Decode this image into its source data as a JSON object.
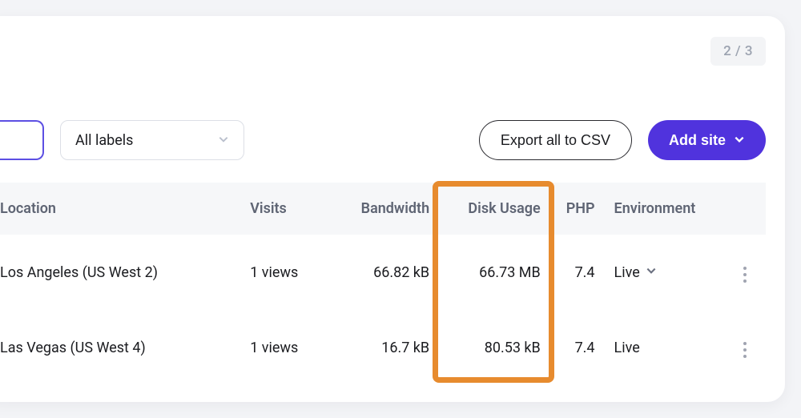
{
  "pagination": {
    "label": "2 / 3"
  },
  "toolbar": {
    "labels_filter": {
      "text": "All labels"
    },
    "export_btn": "Export all to CSV",
    "add_site_btn": "Add site"
  },
  "table": {
    "headers": {
      "location": "Location",
      "visits": "Visits",
      "bandwidth": "Bandwidth",
      "disk": "Disk Usage",
      "php": "PHP",
      "env": "Environment"
    },
    "rows": [
      {
        "location": "Los Angeles (US West 2)",
        "visits": "1 views",
        "bandwidth": "66.82 kB",
        "disk": "66.73 MB",
        "php": "7.4",
        "env": "Live",
        "env_dropdown": true
      },
      {
        "location": "Las Vegas (US West 4)",
        "visits": "1 views",
        "bandwidth": "16.7 kB",
        "disk": "80.53 kB",
        "php": "7.4",
        "env": "Live",
        "env_dropdown": false
      }
    ]
  }
}
